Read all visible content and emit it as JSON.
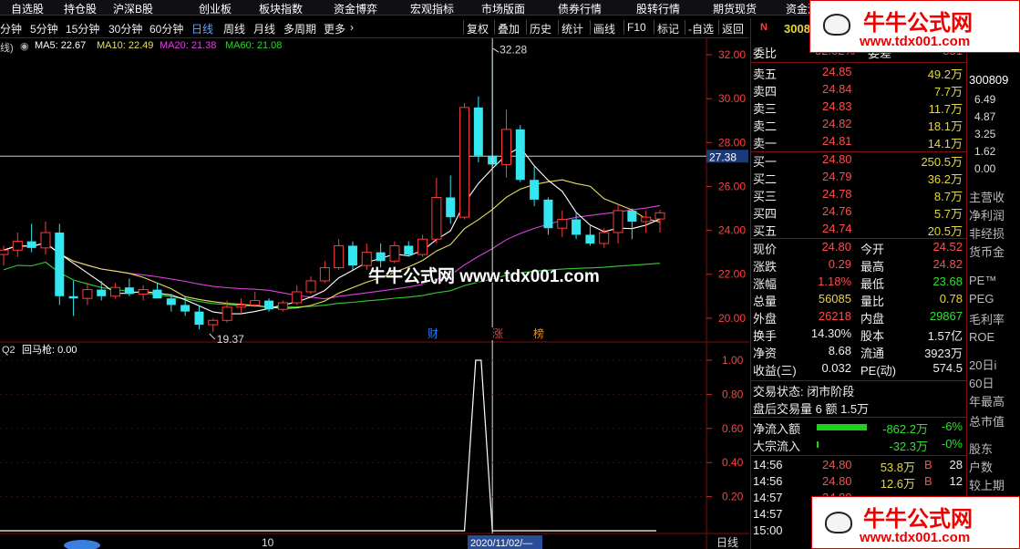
{
  "topnav": [
    "自选股",
    "持仓股",
    "沪深B股",
    "创业板",
    "板块指数",
    "资金博弈",
    "宏观指标",
    "市场版面",
    "债券行情",
    "股转行情",
    "期货现货",
    "资金流向",
    "周末"
  ],
  "periods": [
    "分钟",
    "5分钟",
    "15分钟",
    "30分钟",
    "60分钟",
    "日线",
    "周线",
    "月线",
    "多周期",
    "更多"
  ],
  "active_period": "日线",
  "tools": [
    "复权",
    "叠加",
    "历史",
    "统计",
    "画线",
    "F10",
    "标记",
    "-自选",
    "返回"
  ],
  "indicator_header": {
    "prefix": "线)",
    "ma5": "MA5: 22.67",
    "ma10": "MA10: 22.49",
    "ma20": "MA20: 21.38",
    "ma60": "MA60: 21.08"
  },
  "colors": {
    "up": "#ff3b3b",
    "down": "#33e6f0",
    "ma5": "#ffffff",
    "ma10": "#e8e05a",
    "ma20": "#e040e0",
    "ma60": "#30d030",
    "accent": "#4a90e2"
  },
  "chart_data": {
    "type": "candlestick",
    "ylim": [
      18,
      33
    ],
    "y_ticks": [
      "32.00",
      "30.00",
      "28.00",
      "26.00",
      "24.00",
      "22.00",
      "20.00"
    ],
    "price_marker": "27.38",
    "high_label": "32.28",
    "low_label": "19.37",
    "event_labels": [
      "财",
      "涨",
      "榜"
    ],
    "candles": [
      [
        22.9,
        23.3,
        22.4,
        23.1
      ],
      [
        23.1,
        23.9,
        22.8,
        23.5
      ],
      [
        23.5,
        24.3,
        23.0,
        23.2
      ],
      [
        23.2,
        24.4,
        22.9,
        23.9
      ],
      [
        23.9,
        24.3,
        20.6,
        21.0
      ],
      [
        21.0,
        21.7,
        20.1,
        20.9
      ],
      [
        20.9,
        21.6,
        20.6,
        21.3
      ],
      [
        21.3,
        21.7,
        20.8,
        21.0
      ],
      [
        21.0,
        21.6,
        20.9,
        21.4
      ],
      [
        21.4,
        21.8,
        21.0,
        21.1
      ],
      [
        21.1,
        21.5,
        20.8,
        21.3
      ],
      [
        21.3,
        21.6,
        20.9,
        20.9
      ],
      [
        20.9,
        21.1,
        20.3,
        20.6
      ],
      [
        20.6,
        21.0,
        20.1,
        20.3
      ],
      [
        20.3,
        20.6,
        19.5,
        19.7
      ],
      [
        19.7,
        20.0,
        19.37,
        19.9
      ],
      [
        19.9,
        20.8,
        19.8,
        20.5
      ],
      [
        20.5,
        20.9,
        20.2,
        20.6
      ],
      [
        20.6,
        21.2,
        20.5,
        20.8
      ],
      [
        20.8,
        20.9,
        20.3,
        20.4
      ],
      [
        20.4,
        20.8,
        20.3,
        20.7
      ],
      [
        20.7,
        21.5,
        20.6,
        21.2
      ],
      [
        21.2,
        21.9,
        21.1,
        21.7
      ],
      [
        21.7,
        22.6,
        21.6,
        22.3
      ],
      [
        22.3,
        23.6,
        22.2,
        23.3
      ],
      [
        23.3,
        23.5,
        22.2,
        22.4
      ],
      [
        22.4,
        23.4,
        22.2,
        23.0
      ],
      [
        23.0,
        23.4,
        22.3,
        22.6
      ],
      [
        22.6,
        23.5,
        22.5,
        23.3
      ],
      [
        23.3,
        23.5,
        22.8,
        22.9
      ],
      [
        22.9,
        23.8,
        22.8,
        23.6
      ],
      [
        23.6,
        26.4,
        23.4,
        25.5
      ],
      [
        25.5,
        26.5,
        24.3,
        24.6
      ],
      [
        24.6,
        29.8,
        24.5,
        29.6
      ],
      [
        29.6,
        30.1,
        27.1,
        27.4
      ],
      [
        27.4,
        32.28,
        26.8,
        27.0
      ],
      [
        27.0,
        29.5,
        26.4,
        28.6
      ],
      [
        28.6,
        28.8,
        26.2,
        26.3
      ],
      [
        26.3,
        26.9,
        25.1,
        25.4
      ],
      [
        25.4,
        25.5,
        23.8,
        24.1
      ],
      [
        24.1,
        24.9,
        23.7,
        24.5
      ],
      [
        24.5,
        24.8,
        23.6,
        23.8
      ],
      [
        23.8,
        24.2,
        23.3,
        23.4
      ],
      [
        23.4,
        24.1,
        23.2,
        23.9
      ],
      [
        23.9,
        25.2,
        23.4,
        24.9
      ],
      [
        24.9,
        25.0,
        23.6,
        24.4
      ],
      [
        24.4,
        24.9,
        23.9,
        24.6
      ],
      [
        24.52,
        24.93,
        23.9,
        24.8
      ]
    ],
    "sub_indicator": {
      "name": "回马枪: 0.00",
      "prefix": "Q2",
      "ylim": [
        0,
        1
      ],
      "y_ticks": [
        "1.00",
        "0.80",
        "0.60",
        "0.40",
        "0.20"
      ],
      "values": [
        0,
        0,
        0,
        0,
        0,
        0,
        0,
        0,
        0,
        0,
        0,
        0,
        0,
        0,
        0,
        0,
        0,
        0,
        0,
        0,
        0,
        0,
        0,
        0,
        0,
        0,
        0,
        0,
        0,
        0,
        0,
        0,
        0,
        0,
        1,
        0,
        0,
        0,
        0,
        0,
        0,
        0,
        0,
        0,
        0,
        0,
        0,
        0
      ]
    },
    "x_labels": [
      "10",
      "2020/11/02/—"
    ],
    "bottom_right": "日线"
  },
  "quote": {
    "code_badge": "N",
    "code": "3008",
    "weibi_label": "委比",
    "weibi_value": "32.52%",
    "weicha_label": "委差",
    "weicha_value": "851",
    "sells": [
      {
        "label": "卖五",
        "price": "24.85",
        "vol": "49.2万"
      },
      {
        "label": "卖四",
        "price": "24.84",
        "vol": "7.7万"
      },
      {
        "label": "卖三",
        "price": "24.83",
        "vol": "11.7万"
      },
      {
        "label": "卖二",
        "price": "24.82",
        "vol": "18.1万"
      },
      {
        "label": "卖一",
        "price": "24.81",
        "vol": "14.1万"
      }
    ],
    "buys": [
      {
        "label": "买一",
        "price": "24.80",
        "vol": "250.5万"
      },
      {
        "label": "买二",
        "price": "24.79",
        "vol": "36.2万"
      },
      {
        "label": "买三",
        "price": "24.78",
        "vol": "8.7万"
      },
      {
        "label": "买四",
        "price": "24.76",
        "vol": "5.7万"
      },
      {
        "label": "买五",
        "price": "24.74",
        "vol": "20.5万"
      }
    ],
    "stats": [
      {
        "l1": "现价",
        "v1": "24.80",
        "c1": "red",
        "l2": "今开",
        "v2": "24.52",
        "c2": "red"
      },
      {
        "l1": "涨跌",
        "v1": "0.29",
        "c1": "red",
        "l2": "最高",
        "v2": "24.82",
        "c2": "red"
      },
      {
        "l1": "涨幅",
        "v1": "1.18%",
        "c1": "red",
        "l2": "最低",
        "v2": "23.68",
        "c2": "grn"
      },
      {
        "l1": "总量",
        "v1": "56085",
        "c1": "yel",
        "l2": "量比",
        "v2": "0.78",
        "c2": "yel"
      },
      {
        "l1": "外盘",
        "v1": "26218",
        "c1": "red",
        "l2": "内盘",
        "v2": "29867",
        "c2": "grn"
      },
      {
        "l1": "换手",
        "v1": "14.30%",
        "c1": "wht",
        "l2": "股本",
        "v2": "1.57亿",
        "c2": "wht"
      },
      {
        "l1": "净资",
        "v1": "8.68",
        "c1": "wht",
        "l2": "流通",
        "v2": "3923万",
        "c2": "wht"
      },
      {
        "l1": "收益(三)",
        "v1": "0.032",
        "c1": "wht",
        "l2": "PE(动)",
        "v2": "574.5",
        "c2": "wht"
      }
    ],
    "trade_status": "交易状态: 闭市阶段",
    "after_hours": "盘后交易量 6 额 1.5万",
    "netflow_label": "净流入额",
    "netflow_value": "-862.2万",
    "netflow_pct": "-6%",
    "netflow_level": 0.55,
    "bigflow_label": "大宗流入",
    "bigflow_value": "-32.3万",
    "bigflow_pct": "-0%",
    "ticks": [
      {
        "time": "14:56",
        "price": "24.80",
        "vol": "53.8万",
        "side": "B",
        "n": "28"
      },
      {
        "time": "14:56",
        "price": "24.80",
        "vol": "12.6万",
        "side": "B",
        "n": "12"
      },
      {
        "time": "14:57",
        "price": "24.80",
        "vol": "",
        "side": "",
        "n": ""
      },
      {
        "time": "14:57",
        "price": "",
        "vol": "",
        "side": "",
        "n": ""
      },
      {
        "time": "15:00",
        "price": "",
        "vol": "",
        "side": "",
        "n": ""
      }
    ]
  },
  "far_panel": [
    "300809",
    "6.49",
    "4.87",
    "3.25",
    "1.62",
    "0.00",
    "主营收",
    "净利润",
    "非经损",
    "货币金",
    "PE™",
    "PEG",
    "毛利率",
    "ROE",
    "20日i",
    "60日",
    "年最高",
    "总市值",
    "股东",
    "户数",
    "较上期"
  ],
  "watermark": {
    "brand": "牛牛公式网",
    "url": "www.tdx001.com",
    "center": "牛牛公式网 www.tdx001.com"
  }
}
